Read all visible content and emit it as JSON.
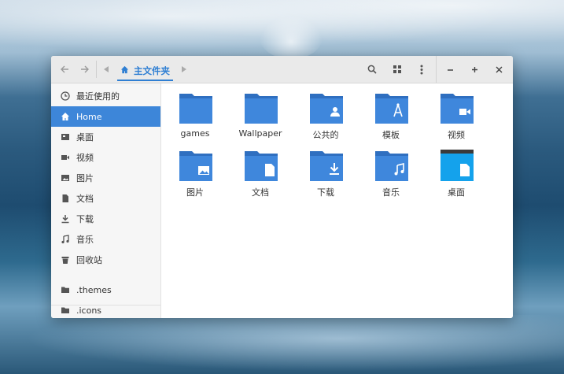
{
  "titlebar": {
    "breadcrumb": "主文件夹"
  },
  "sidebar": {
    "items": [
      {
        "label": "最近使用的",
        "icon": "clock-icon"
      },
      {
        "label": "Home",
        "icon": "home-icon"
      },
      {
        "label": "桌面",
        "icon": "desktop-icon"
      },
      {
        "label": "视频",
        "icon": "video-icon"
      },
      {
        "label": "图片",
        "icon": "image-icon"
      },
      {
        "label": "文档",
        "icon": "document-icon"
      },
      {
        "label": "下载",
        "icon": "download-icon"
      },
      {
        "label": "音乐",
        "icon": "music-icon"
      },
      {
        "label": "回收站",
        "icon": "trash-icon"
      },
      {
        "label": ".themes",
        "icon": "folder-icon"
      },
      {
        "label": ".icons",
        "icon": "folder-icon"
      }
    ],
    "active": "Home"
  },
  "files": [
    {
      "name": "games",
      "icon": "folder-icon"
    },
    {
      "name": "Wallpaper",
      "icon": "folder-icon"
    },
    {
      "name": "公共的",
      "icon": "public-folder-icon"
    },
    {
      "name": "模板",
      "icon": "templates-folder-icon"
    },
    {
      "name": "视频",
      "icon": "videos-folder-icon"
    },
    {
      "name": "图片",
      "icon": "pictures-folder-icon"
    },
    {
      "name": "文档",
      "icon": "documents-folder-icon"
    },
    {
      "name": "下载",
      "icon": "downloads-folder-icon"
    },
    {
      "name": "音乐",
      "icon": "music-folder-icon"
    },
    {
      "name": "桌面",
      "icon": "desktop-folder-icon"
    }
  ],
  "colors": {
    "accent": "#3d86d9",
    "folder": "#3f87dc",
    "folder_tab": "#2f6fc0"
  }
}
